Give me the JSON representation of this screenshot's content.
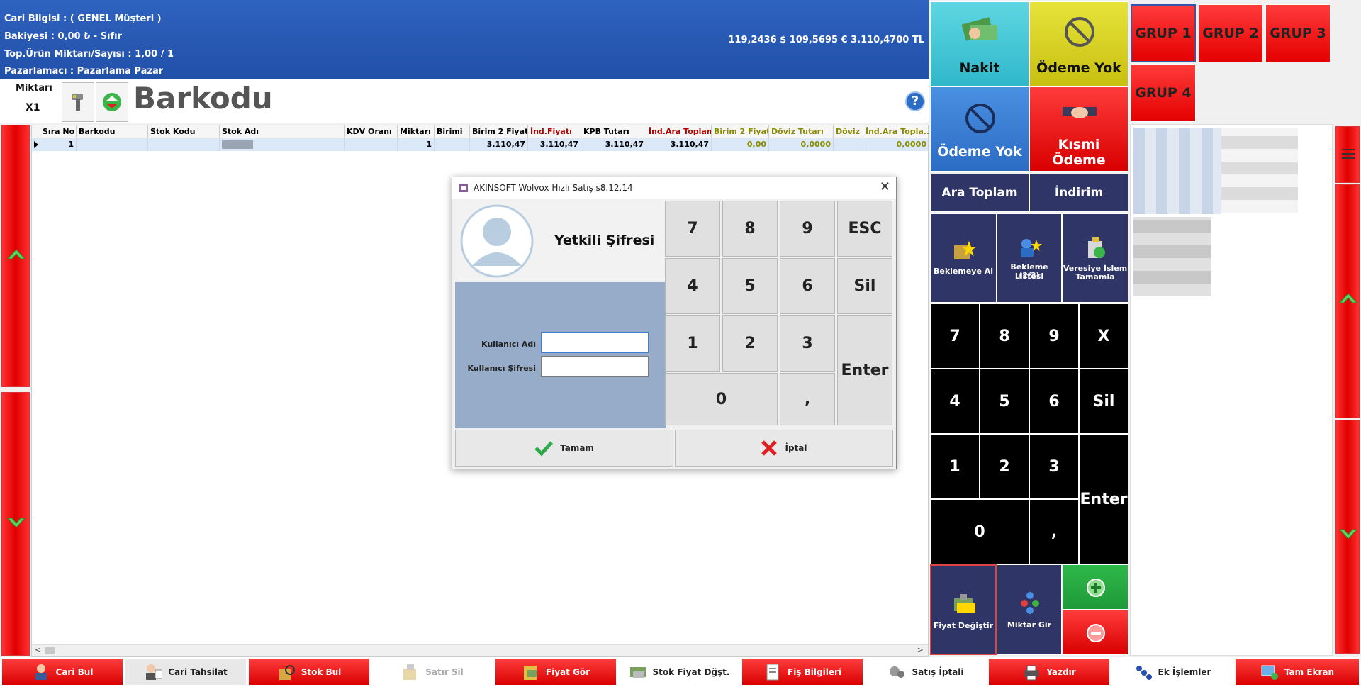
{
  "header": {
    "cari_bilgisi": "Cari Bilgisi : ( GENEL Müşteri )",
    "bakiye": "Bakiyesi : 0,00 ₺ - Sıfır",
    "top_urun": "Top.Ürün Miktarı/Sayısı : 1,00  /  1",
    "pazarlamaci": "Pazarlamacı : Pazarlama Pazar",
    "rates": "119,2436 $  109,5695 €  3.110,4700 TL"
  },
  "barcode_row": {
    "qty_label": "Miktarı",
    "qty_value": "X1",
    "title": "Barkodu",
    "help": "?"
  },
  "grid": {
    "columns": [
      "Sıra No",
      "Barkodu",
      "Stok Kodu",
      "Stok Adı",
      "KDV Oranı",
      "Miktarı",
      "Birimi",
      "Birim 2 Fiyatı",
      "İnd.Fiyatı",
      "KPB Tutarı",
      "İnd.Ara Toplam",
      "Birim 2 Fiyatı",
      "Döviz Tutarı",
      "Döviz",
      "İnd.Ara Topla..."
    ],
    "row": {
      "sira": "1",
      "miktar": "1",
      "birim2_fiyati": "3.110,47",
      "ind_fiyati": "3.110,47",
      "kpb_tutari": "3.110,47",
      "ind_ara_toplam": "3.110,47",
      "birim2_fiyati_doviz": "0,00",
      "doviz_tutari": "0,0000",
      "ind_ara_toplam_doviz": "0,0000"
    },
    "scroll_left": "<",
    "scroll_right": ">"
  },
  "payment": {
    "nakit": "Nakit",
    "odeme_yok_1": "Ödeme Yok",
    "odeme_yok_2": "Ödeme Yok",
    "kismi_odeme_1": "Kısmi",
    "kismi_odeme_2": "Ödeme",
    "ara_toplam": "Ara Toplam",
    "indirim": "İndirim",
    "beklemeye_al": "Beklemeye Al",
    "bekleme_listesi_1": "Bekleme Listesi",
    "bekleme_listesi_2": "(2/3)",
    "veresiye_1": "Veresiye İşlem",
    "veresiye_2": "Tamamla",
    "fiyat_degistir": "Fiyat Değiştir",
    "miktar_gir": "Miktar Gir"
  },
  "numpad": {
    "k7": "7",
    "k8": "8",
    "k9": "9",
    "kx": "X",
    "k4": "4",
    "k5": "5",
    "k6": "6",
    "ksil": "Sil",
    "k1": "1",
    "k2": "2",
    "k3": "3",
    "kenter": "Enter",
    "k0": "0",
    "kcomma": ","
  },
  "groups": [
    "GRUP 1",
    "GRUP 2",
    "GRUP 3",
    "GRUP 4"
  ],
  "toolbar": {
    "cari_bul": "Cari Bul",
    "cari_tahsilat": "Cari Tahsilat",
    "stok_bul": "Stok Bul",
    "satir_sil": "Satır Sil",
    "fiyat_gor": "Fiyat Gör",
    "stok_fiyat_dgst": "Stok Fiyat Dğşt.",
    "fis_bilgileri": "Fiş Bilgileri",
    "satis_iptali": "Satış İptali",
    "yazdir": "Yazdır",
    "ek_islemler": "Ek İşlemler",
    "tam_ekran": "Tam Ekran"
  },
  "dialog": {
    "title": "AKINSOFT Wolvox Hızlı Satış s8.12.14",
    "heading": "Yetkili Şifresi",
    "username_label": "Kullanıcı Adı",
    "password_label": "Kullanıcı Şifresi",
    "username_value": "",
    "password_value": "",
    "keys": {
      "k7": "7",
      "k8": "8",
      "k9": "9",
      "esc": "ESC",
      "k4": "4",
      "k5": "5",
      "k6": "6",
      "sil": "Sil",
      "k1": "1",
      "k2": "2",
      "k3": "3",
      "enter": "Enter",
      "k0": "0",
      "comma": ","
    },
    "ok": "Tamam",
    "cancel": "İptal"
  },
  "colors": {
    "header_blue": "#2a5cb8",
    "accent_red": "#e60000",
    "tile_dark": "#2f3566",
    "nakit_cyan": "#3cc6d6",
    "odeme_yellow": "#d8d020"
  }
}
